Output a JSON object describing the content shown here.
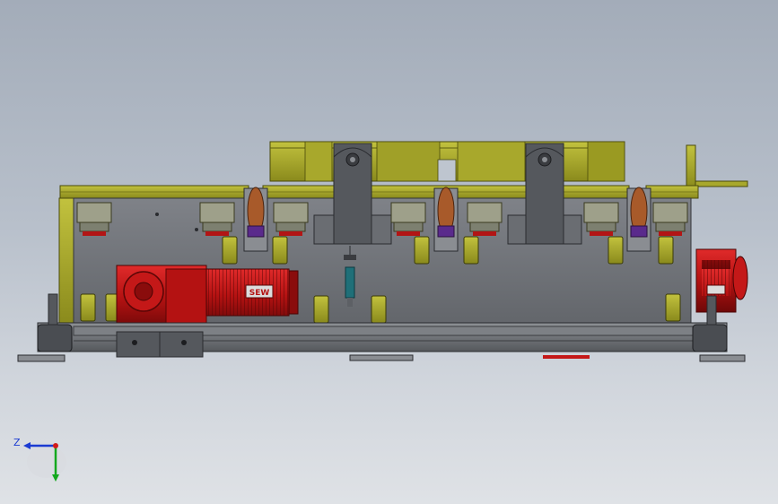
{
  "view": {
    "type": "cad-assembly-side-view",
    "background_top": "#a3acb9",
    "background_bottom": "#dfe2e6"
  },
  "colors": {
    "olive": "#9a9a22",
    "olive_light": "#b8b83a",
    "olive_dark": "#6e6e14",
    "steel": "#6c6f74",
    "steel_light": "#8e9196",
    "steel_dark": "#3c3e42",
    "motor_red": "#c41818",
    "motor_dark": "#7a0c0c",
    "purple": "#5a2a8c",
    "teal": "#1f6f78"
  },
  "motor": {
    "label": "SEW"
  },
  "triad": {
    "z_label": "Z",
    "x_color": "#d21b1b",
    "y_color": "#13a81e",
    "z_color": "#1b3bd2"
  }
}
